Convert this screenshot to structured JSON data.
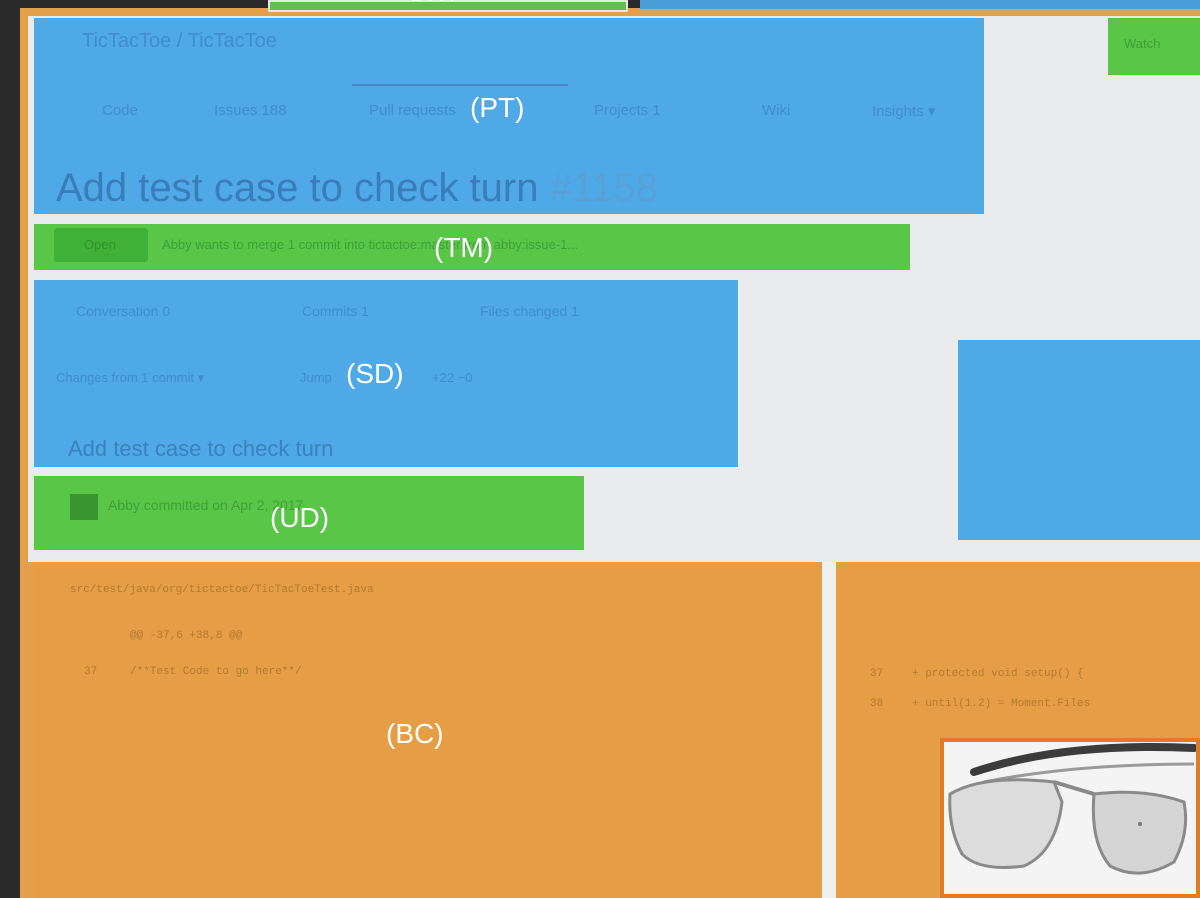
{
  "repo": {
    "owner": "TicTacToe",
    "name": "TicTacToe",
    "breadcrumb": "TicTacToe / TicTacToe",
    "watch_label": "Watch"
  },
  "repo_tabs": [
    {
      "label": "Code"
    },
    {
      "label": "Issues 188"
    },
    {
      "label": "Pull requests"
    },
    {
      "label": "Projects 1"
    },
    {
      "label": "Wiki"
    },
    {
      "label": "Insights ▾"
    }
  ],
  "pull_request": {
    "title": "Add test case to check turn",
    "number": "#1158",
    "state": "Open",
    "merge_summary": "Abby wants to merge 1 commit into tictactoe:master from abby:issue-1..."
  },
  "pr_tabs": [
    {
      "label": "Conversation",
      "count": "0"
    },
    {
      "label": "Commits",
      "count": "1"
    },
    {
      "label": "Files changed",
      "count": "1"
    }
  ],
  "diff_toolbar": {
    "changes_from": "Changes from 1 commit ▾",
    "jump_to": "Jump",
    "stats": "+22 −0"
  },
  "commit": {
    "message": "Add test case to check turn",
    "author_line": "Abby committed on Apr 2, 2017"
  },
  "diff": {
    "file_path": "src/test/java/org/tictactoe/TicTacToeTest.java",
    "left_lines": [
      {
        "num": "",
        "text": "@@ -37,6 +38,8 @@"
      },
      {
        "num": "37",
        "text": "    /**Test Code to go here**/"
      }
    ],
    "right_lines": [
      {
        "num": "37",
        "text": "+      protected void setup() {"
      },
      {
        "num": "38",
        "text": "+        until(1.2) = Moment.Files"
      }
    ]
  },
  "annotations": [
    {
      "code": "DNT"
    },
    {
      "code": "PT"
    },
    {
      "code": "TM"
    },
    {
      "code": "SD"
    },
    {
      "code": "UD"
    },
    {
      "code": "BC"
    }
  ],
  "colors": {
    "blue_region": "#4ea9e6",
    "green_region": "#5ac648",
    "orange_region": "#e59d46",
    "frame_orange": "#e3a049",
    "glasses_border": "#e07b26"
  },
  "product_image": {
    "icon": "glasses-icon"
  }
}
